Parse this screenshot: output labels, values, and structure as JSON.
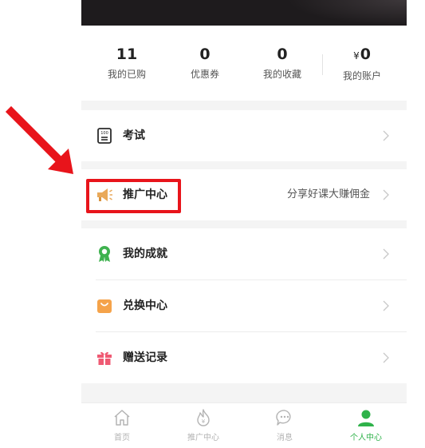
{
  "stats": [
    {
      "value": "11",
      "label": "我的已购"
    },
    {
      "value": "0",
      "label": "优惠券"
    },
    {
      "value": "0",
      "label": "我的收藏"
    },
    {
      "currency": "¥",
      "value": "0",
      "label": "我的账户"
    }
  ],
  "menu": {
    "exam": {
      "label": "考试",
      "icon": "exam-icon"
    },
    "promo": {
      "label": "推广中心",
      "hint": "分享好课大赚佣金",
      "icon": "megaphone-icon"
    },
    "achievements": {
      "label": "我的成就",
      "icon": "medal-icon"
    },
    "exchange": {
      "label": "兑换中心",
      "icon": "bag-icon"
    },
    "gift": {
      "label": "赠送记录",
      "icon": "gift-icon"
    }
  },
  "tabbar": [
    {
      "label": "首页",
      "icon": "home-icon",
      "active": false
    },
    {
      "label": "推广中心",
      "icon": "flame-icon",
      "active": false
    },
    {
      "label": "消息",
      "icon": "chat-icon",
      "active": false
    },
    {
      "label": "个人中心",
      "icon": "person-icon",
      "active": true
    }
  ],
  "colors": {
    "accent": "#2fb24a",
    "annotation_red": "#e8141b",
    "header_dark": "#1e1b1d",
    "section_gap": "#f4f4f4",
    "exam_icon": "#2b2b2b",
    "megaphone_icon": "#e9a95a",
    "medal_icon": "#3fb24f",
    "bag_icon": "#f5a34a",
    "gift_icon": "#ef5a73"
  }
}
